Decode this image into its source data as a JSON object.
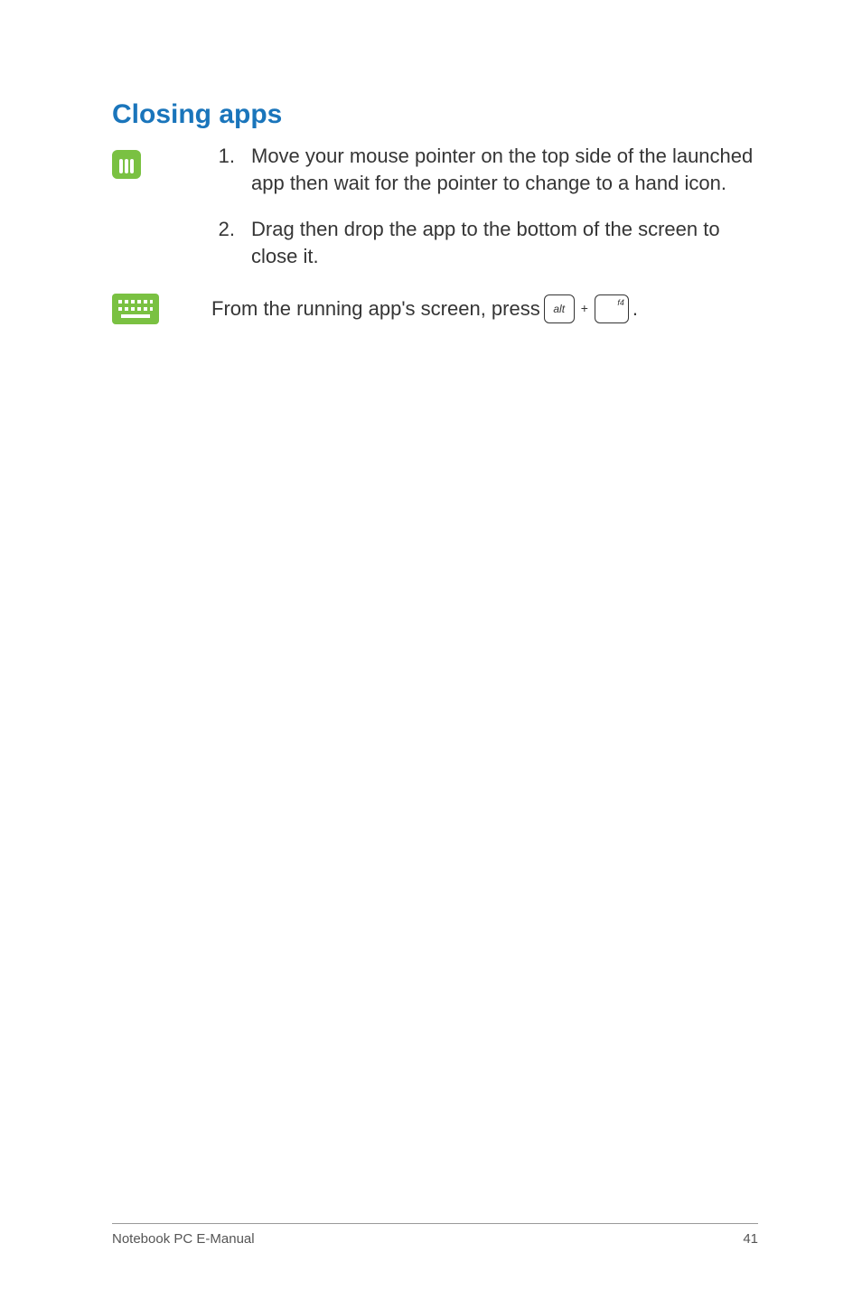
{
  "heading": "Closing apps",
  "mouse": {
    "steps": [
      {
        "num": "1.",
        "text": "Move your mouse pointer on the top side of the launched app then wait for the pointer to change to a hand icon."
      },
      {
        "num": "2.",
        "text": "Drag then drop the app to the bottom of the screen to close it."
      }
    ]
  },
  "keyboard": {
    "prefix": "From the running app's screen, press ",
    "key1": "alt",
    "plus": "+",
    "key2": "f4",
    "suffix": "."
  },
  "footer": {
    "left": "Notebook PC E-Manual",
    "right": "41"
  }
}
